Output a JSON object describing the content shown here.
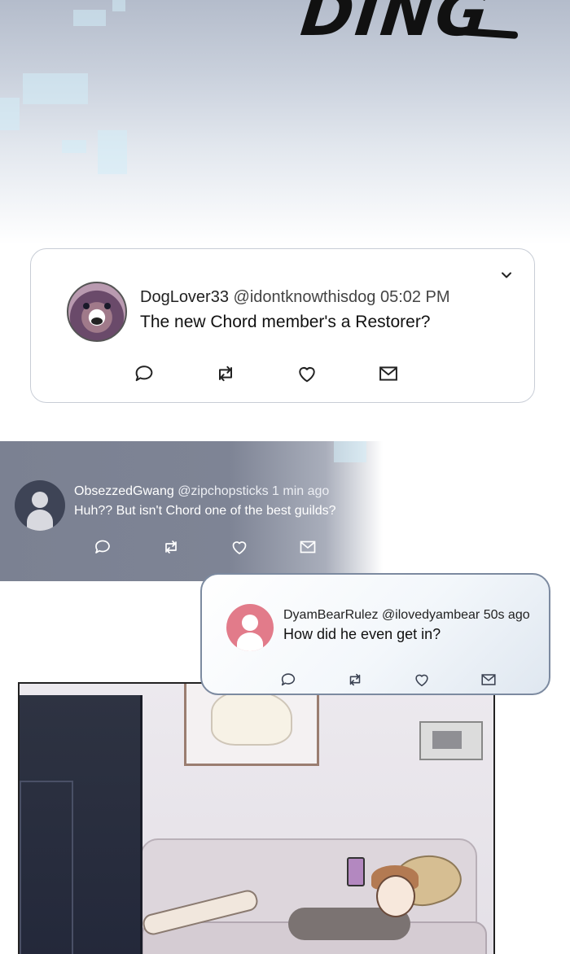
{
  "sound_effect": "DING",
  "tweets": [
    {
      "username": "DogLover33",
      "handle": "@idontknowthisdog",
      "time": "05:02 PM",
      "text": "The new Chord member's a Restorer?",
      "avatar": "dog-avatar"
    },
    {
      "username": "ObsezzedGwang",
      "handle": "@zipchopsticks",
      "time": "1 min ago",
      "text": "Huh?? But isn't Chord one of the best guilds?",
      "avatar": "default-avatar-dark"
    },
    {
      "username": "DyamBearRulez",
      "handle": "@ilovedyambear",
      "time": "50s ago",
      "text": "How did he even get in?",
      "avatar": "default-avatar-pink"
    }
  ],
  "action_icons": [
    "reply-icon",
    "retweet-icon",
    "like-icon",
    "message-icon"
  ],
  "colors": {
    "band": "#7b8192",
    "pink_avatar": "#e27b8a",
    "card_border": "#7c8aa0"
  }
}
